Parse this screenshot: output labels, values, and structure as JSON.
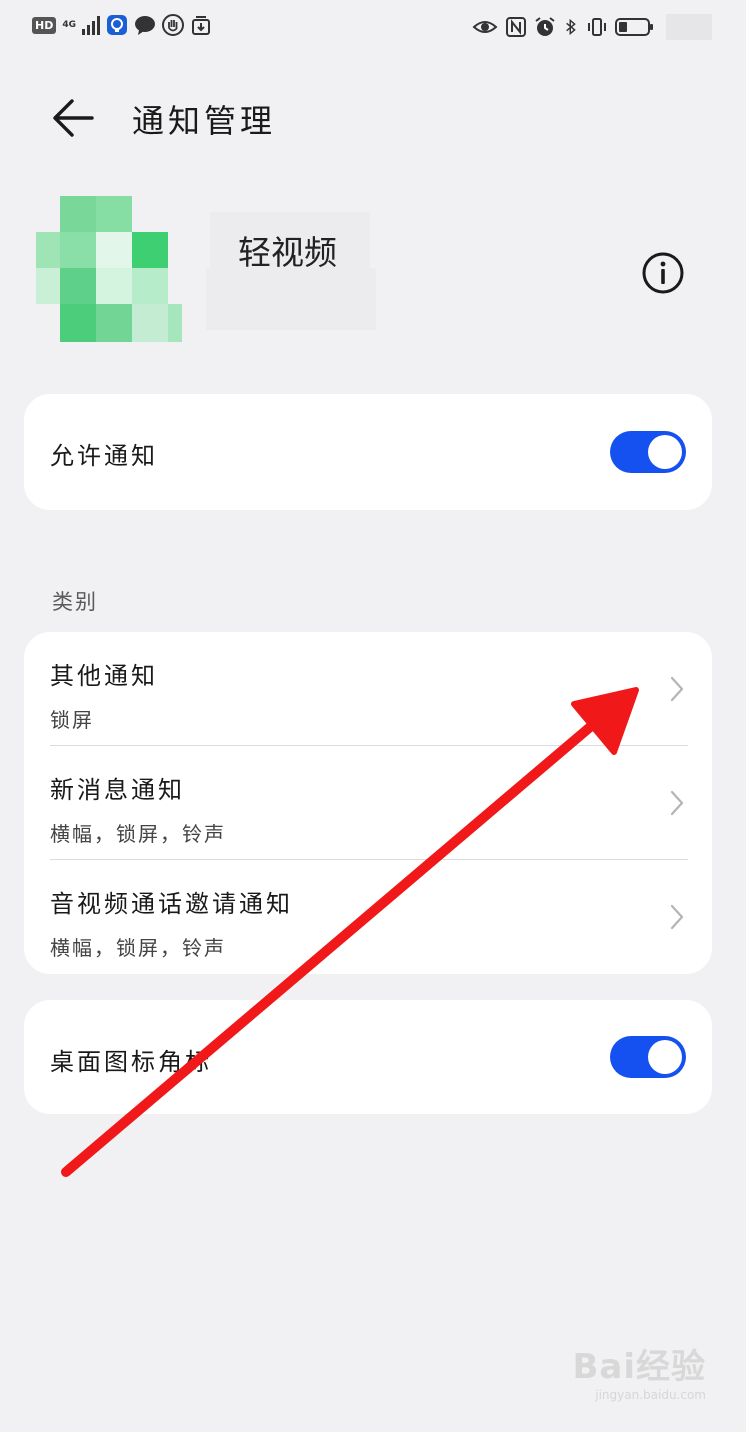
{
  "status_bar": {
    "hd": "HD",
    "network": "4G",
    "icons_left": [
      "hd-icon",
      "signal-icon",
      "bulb-app-icon",
      "chat-bubble-icon",
      "hand-app-icon",
      "download-app-icon"
    ],
    "icons_right": [
      "eye-icon",
      "nfc-icon",
      "alarm-icon",
      "bluetooth-icon",
      "vibrate-icon",
      "battery-icon"
    ]
  },
  "header": {
    "title": "通知管理"
  },
  "app": {
    "name": "轻视频"
  },
  "allow_notifications": {
    "label": "允许通知",
    "enabled": true
  },
  "category": {
    "section_title": "类别",
    "items": [
      {
        "label": "其他通知",
        "sub": "锁屏"
      },
      {
        "label": "新消息通知",
        "sub": "横幅，锁屏，铃声"
      },
      {
        "label": "音视频通话邀请通知",
        "sub": "横幅，锁屏，铃声"
      }
    ]
  },
  "desktop_badge": {
    "label": "桌面图标角标",
    "enabled": true
  },
  "colors": {
    "toggle_on": "#1551f0",
    "annotation_arrow": "#f01818",
    "background": "#f1f1f3",
    "card": "#ffffff"
  },
  "watermark": {
    "logo": "Bai经验",
    "url": "jingyan.baidu.com"
  }
}
